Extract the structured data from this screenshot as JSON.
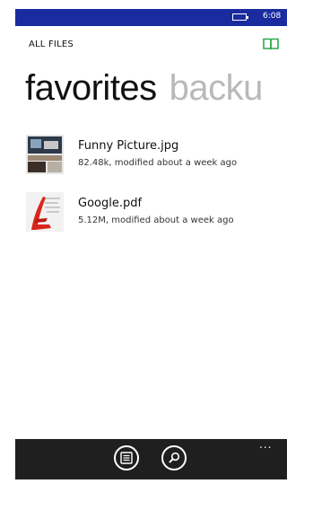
{
  "status_bar": {
    "time": "6:08",
    "background": "#1a2ba0"
  },
  "header": {
    "title": "ALL FILES",
    "icon": "book-icon",
    "icon_color": "#2fa84f"
  },
  "pivot": {
    "active": "favorites",
    "next": "backu"
  },
  "files": [
    {
      "name": "Funny Picture.jpg",
      "meta": "82.48k, modified about a week ago",
      "thumb": "image-thumbnail"
    },
    {
      "name": "Google.pdf",
      "meta": "5.12M, modified about a week ago",
      "thumb": "pdf-thumbnail",
      "accent": "#d9261c"
    }
  ],
  "app_bar": {
    "buttons": [
      "list-icon",
      "search-icon"
    ],
    "more": "..."
  }
}
